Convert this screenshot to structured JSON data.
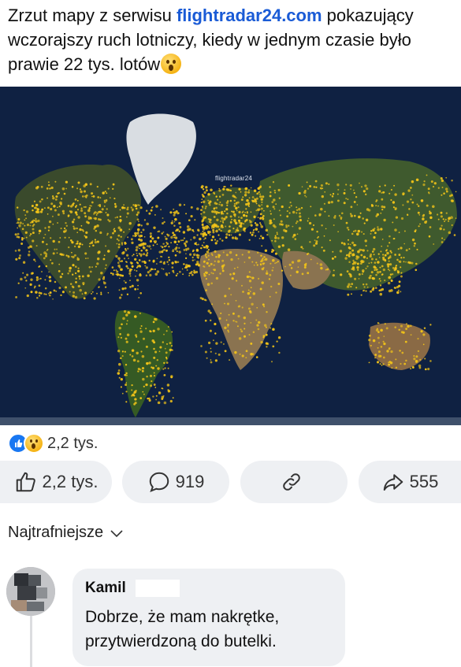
{
  "post": {
    "text_before": "Zrzut mapy z serwisu ",
    "link_text": "flightradar24.com",
    "text_after": " pokazujący wczorajszy ruch lotniczy, kiedy w jednym czasie było prawie 22 tys. lotów",
    "emoji": "hushed-face-emoji"
  },
  "map": {
    "watermark": "flightradar24",
    "ocean_color": "#0e1f3d",
    "flight_color": "#f2c418"
  },
  "reactions": {
    "icons": [
      "like-icon",
      "wow-icon"
    ],
    "count": "2,2 tys."
  },
  "actions": {
    "like_count": "2,2 tys.",
    "comment_count": "919",
    "share_count": "555"
  },
  "comments": {
    "sort_label": "Najtrafniejsze",
    "first": {
      "author": "Kamil",
      "text": "Dobrze, że mam nakrętke, przytwierdzoną do butelki."
    }
  }
}
